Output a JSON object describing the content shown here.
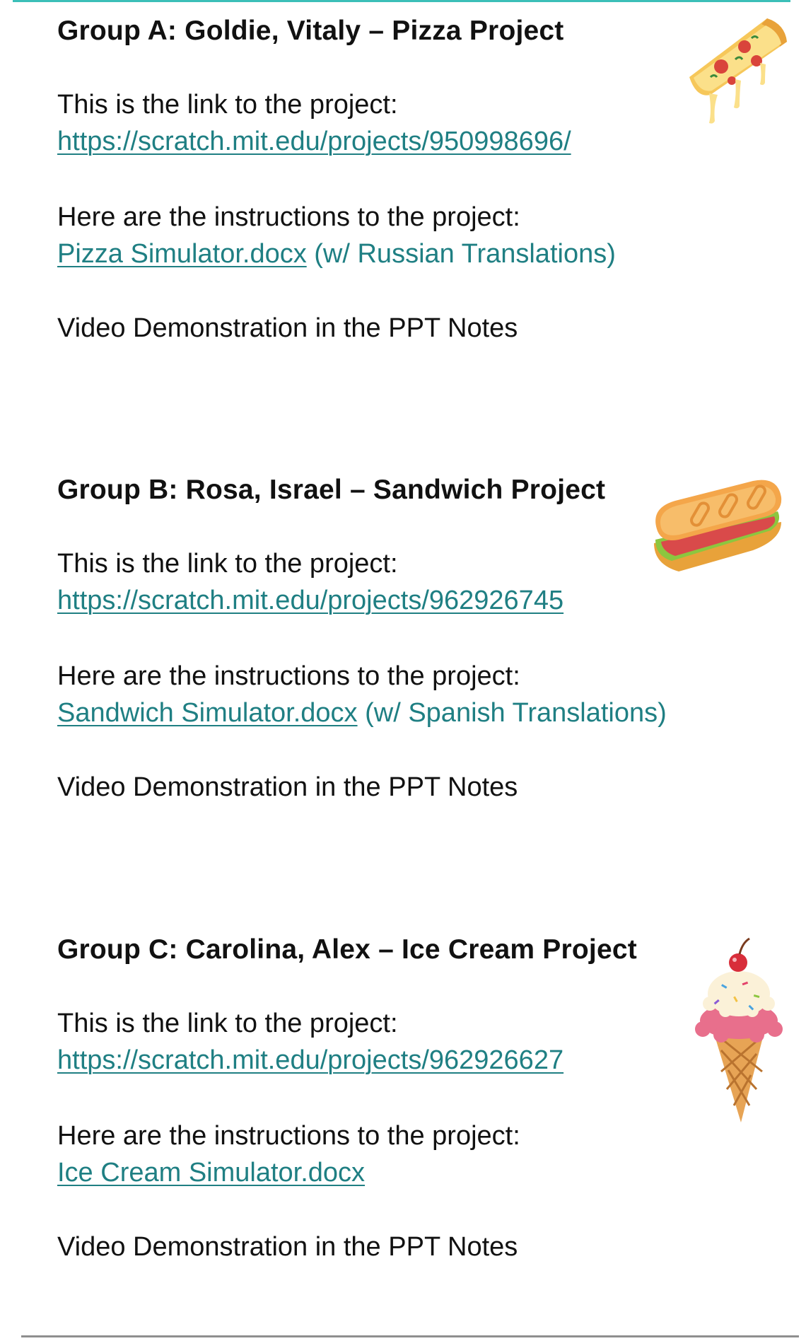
{
  "groups": [
    {
      "heading": "Group A: Goldie, Vitaly – Pizza Project",
      "link_intro": "This is the link to the project:",
      "project_url": "https://scratch.mit.edu/projects/950998696/",
      "instructions_intro": "Here are the instructions to the project:",
      "doc_link": "Pizza Simulator.docx",
      "doc_note": " (w/ Russian Translations)",
      "video_note": "Video Demonstration in the PPT Notes",
      "icon": "pizza-slice-icon"
    },
    {
      "heading": "Group B: Rosa, Israel – Sandwich Project",
      "link_intro": "This is the link to the project:",
      "project_url": "https://scratch.mit.edu/projects/962926745",
      "instructions_intro": "Here are the instructions to the project:",
      "doc_link": "Sandwich Simulator.docx",
      "doc_note": " (w/ Spanish Translations)",
      "video_note": "Video Demonstration in the PPT Notes",
      "icon": "sandwich-icon"
    },
    {
      "heading": "Group C: Carolina, Alex – Ice Cream Project",
      "link_intro": "This is the link to the project:",
      "project_url": "https://scratch.mit.edu/projects/962926627",
      "instructions_intro": "Here are the instructions to the project:",
      "doc_link": "Ice Cream Simulator.docx",
      "doc_note": "",
      "video_note": "Video Demonstration in the PPT Notes",
      "icon": "ice-cream-cone-icon"
    }
  ],
  "colors": {
    "link": "#1f7f83",
    "text": "#111111",
    "top_rule": "#3bbfb8"
  }
}
